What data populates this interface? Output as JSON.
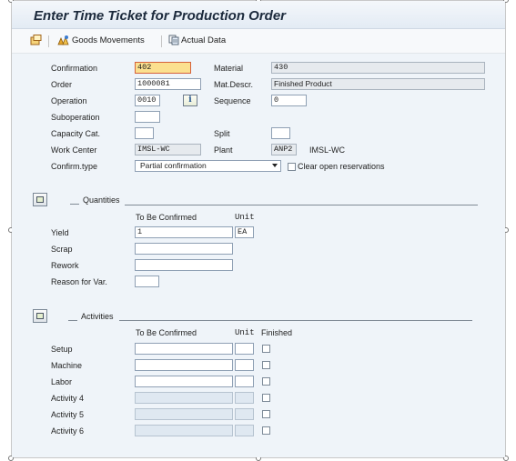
{
  "window": {
    "title": "Enter Time Ticket for Production Order"
  },
  "toolbar": {
    "goods_movements": "Goods Movements",
    "actual_data": "Actual Data"
  },
  "header": {
    "confirmation_label": "Confirmation",
    "confirmation_value": "402",
    "material_label": "Material",
    "material_value": "430",
    "order_label": "Order",
    "order_value": "1000081",
    "mat_descr_label": "Mat.Descr.",
    "mat_descr_value": "Finished Product",
    "operation_label": "Operation",
    "operation_value": "0010",
    "sequence_label": "Sequence",
    "sequence_value": "0",
    "suboperation_label": "Suboperation",
    "capacity_cat_label": "Capacity Cat.",
    "split_label": "Split",
    "work_center_label": "Work Center",
    "work_center_value": "IMSL-WC",
    "plant_label": "Plant",
    "plant_value": "ANP2",
    "plant_desc": "IMSL-WC",
    "confirm_type_label": "Confirm.type",
    "confirm_type_value": "Partial confirmation",
    "clear_open_label": "Clear open reservations"
  },
  "quantities": {
    "title": "Quantities",
    "col_to_be_confirmed": "To Be Confirmed",
    "col_unit": "Unit",
    "yield_label": "Yield",
    "yield_value": "1",
    "yield_unit": "EA",
    "scrap_label": "Scrap",
    "rework_label": "Rework",
    "reason_label": "Reason for Var."
  },
  "activities": {
    "title": "Activities",
    "col_to_be_confirmed": "To Be Confirmed",
    "col_unit": "Unit",
    "col_finished": "Finished",
    "rows": [
      {
        "label": "Setup"
      },
      {
        "label": "Machine"
      },
      {
        "label": "Labor"
      },
      {
        "label": "Activity 4"
      },
      {
        "label": "Activity 5"
      },
      {
        "label": "Activity 6"
      }
    ]
  }
}
